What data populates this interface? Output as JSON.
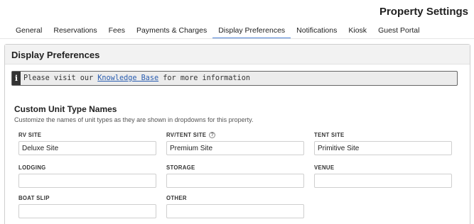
{
  "header": {
    "title": "Property Settings"
  },
  "tabs": [
    {
      "label": "General",
      "active": false
    },
    {
      "label": "Reservations",
      "active": false
    },
    {
      "label": "Fees",
      "active": false
    },
    {
      "label": "Payments & Charges",
      "active": false
    },
    {
      "label": "Display Preferences",
      "active": true
    },
    {
      "label": "Notifications",
      "active": false
    },
    {
      "label": "Kiosk",
      "active": false
    },
    {
      "label": "Guest Portal",
      "active": false
    }
  ],
  "colors": {
    "active_tab_underline": "#4a7fd4",
    "link": "#2a5db0"
  },
  "panel": {
    "title": "Display Preferences",
    "info": {
      "icon": "info-icon",
      "prefix": "Please visit our ",
      "link_text": "Knowledge Base",
      "suffix": " for more information"
    },
    "section": {
      "title": "Custom Unit Type Names",
      "description": "Customize the names of unit types as they are shown in dropdowns for this property."
    },
    "fields": [
      {
        "label": "RV SITE",
        "value": "Deluxe Site",
        "help": false
      },
      {
        "label": "RV/TENT SITE",
        "value": "Premium Site",
        "help": true
      },
      {
        "label": "TENT SITE",
        "value": "Primitive Site",
        "help": false
      },
      {
        "label": "LODGING",
        "value": "",
        "help": false
      },
      {
        "label": "STORAGE",
        "value": "",
        "help": false
      },
      {
        "label": "VENUE",
        "value": "",
        "help": false
      },
      {
        "label": "BOAT SLIP",
        "value": "",
        "help": false
      },
      {
        "label": "OTHER",
        "value": "",
        "help": false
      }
    ]
  }
}
